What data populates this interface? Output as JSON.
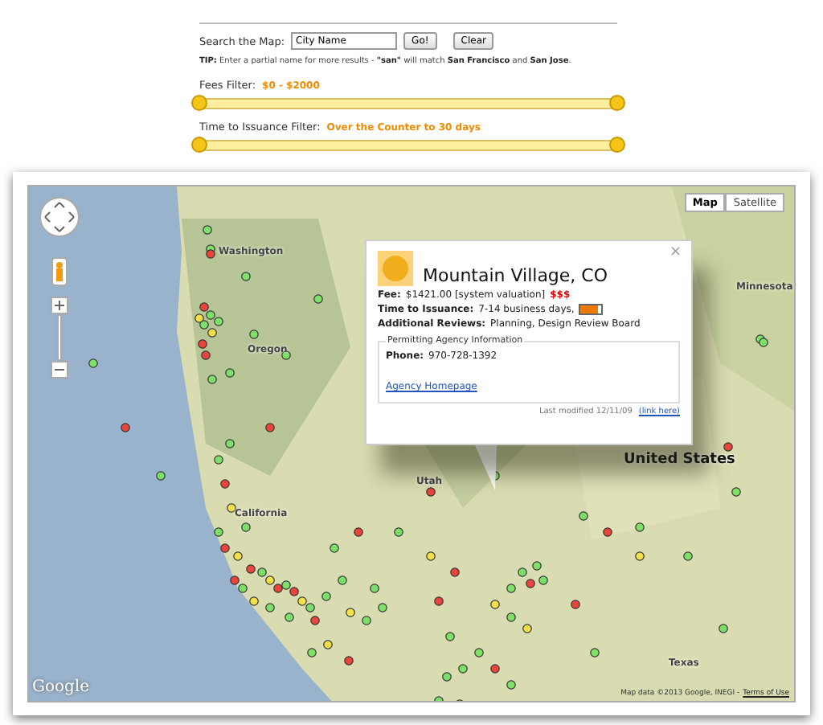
{
  "search": {
    "label": "Search the Map:",
    "value": "City Name",
    "buttons": [
      "Go!",
      "Clear"
    ]
  },
  "tip": "**TIP:** Enter a partial name for more results - **\"san\"** will match **San Francisco** and **San Jose**.",
  "filters": [
    {
      "label": "Fees Filter:",
      "value": "$0 - $2000",
      "thumbs": [
        {
          "level": 0
        },
        {
          "level": 1
        }
      ]
    },
    {
      "label": "Time to Issuance Filter:",
      "value": "Over the Counter to 30 days",
      "thumbs": [
        {
          "level": 0
        },
        {
          "level": 1
        }
      ]
    }
  ],
  "map": {
    "types": [
      {
        "label": "Map",
        "selected": true
      },
      {
        "label": "Satellite",
        "selected": false
      }
    ],
    "labels": [
      "Washington",
      "Oregon",
      "California",
      "Utah",
      "Minnesota",
      "Texas",
      "United States"
    ],
    "logo": "Google",
    "attribution": "Map data ©2013 Google, INEGI -",
    "terms": "Terms of Use"
  },
  "popup": {
    "close": "×",
    "title": "Mountain Village, CO",
    "fee": {
      "label": "Fee:",
      "value": "$1421.00 [system valuation]",
      "rating": "$$$"
    },
    "time": {
      "label": "Time to Issuance:",
      "value": "7-14 business days,",
      "level": 0.8
    },
    "reviews": {
      "label": "Additional Reviews:",
      "value": "Planning, Design Review Board"
    },
    "agency": {
      "legend": "Permitting Agency Information",
      "phone_label": "Phone:",
      "phone": "970-728-1392",
      "link": "Agency Homepage"
    },
    "modified": "Last modified 12/11/09",
    "link": "(link here)"
  }
}
